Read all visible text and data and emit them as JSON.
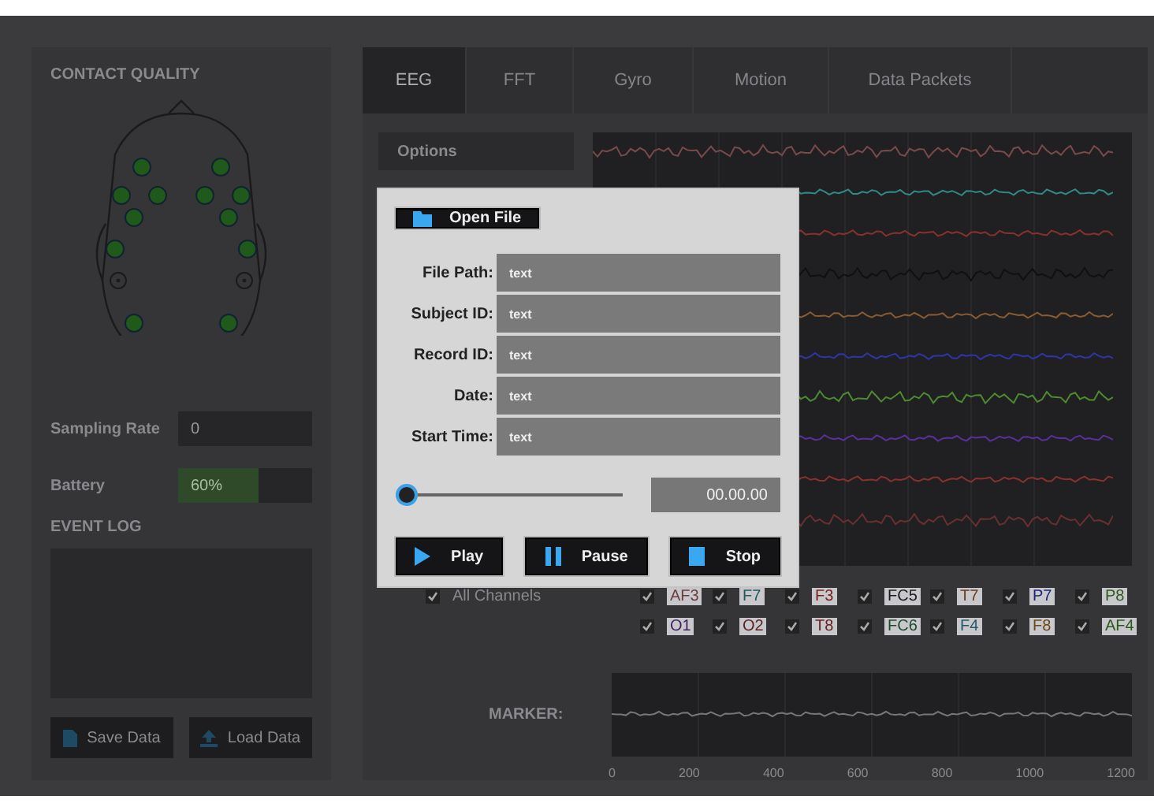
{
  "left_panel": {
    "title": "CONTACT QUALITY",
    "sampling_rate": {
      "label": "Sampling Rate",
      "value": "0"
    },
    "battery": {
      "label": "Battery",
      "level": 0.6,
      "reading": "60%"
    },
    "event_log": {
      "title": "EVENT LOG"
    },
    "buttons": [
      {
        "label": "Save Data",
        "kind": "save"
      },
      {
        "label": "Load Data",
        "kind": "load"
      }
    ]
  },
  "tabs": [
    {
      "label": "EEG",
      "selected": true
    },
    {
      "label": "FFT",
      "selected": false
    },
    {
      "label": "Gyro",
      "selected": false
    },
    {
      "label": "Motion",
      "selected": false
    },
    {
      "label": "Data Packets",
      "selected": false
    }
  ],
  "options": {
    "label": "Options"
  },
  "channels": {
    "all": {
      "label": "All Channels",
      "checked": true
    },
    "items": [
      {
        "label": "AF3",
        "checked": true,
        "color": "#6a3d3d"
      },
      {
        "label": "F7",
        "checked": true,
        "color": "#1f5a58"
      },
      {
        "label": "F3",
        "checked": true,
        "color": "#7a1e1e"
      },
      {
        "label": "FC5",
        "checked": true,
        "color": "#1a1a1a"
      },
      {
        "label": "T7",
        "checked": true,
        "color": "#6a3a1a"
      },
      {
        "label": "P7",
        "checked": true,
        "color": "#1e237a"
      },
      {
        "label": "P8",
        "checked": true,
        "color": "#2f5a1e"
      },
      {
        "label": "O1",
        "checked": true,
        "color": "#3e1f5c"
      },
      {
        "label": "O2",
        "checked": true,
        "color": "#5a1f1f"
      },
      {
        "label": "T8",
        "checked": true,
        "color": "#6a2020"
      },
      {
        "label": "FC6",
        "checked": true,
        "color": "#1f4a2a"
      },
      {
        "label": "F4",
        "checked": true,
        "color": "#1f5a66"
      },
      {
        "label": "F8",
        "checked": true,
        "color": "#6a4a14"
      },
      {
        "label": "AF4",
        "checked": true,
        "color": "#2a5a1a"
      }
    ]
  },
  "marker": {
    "label": "MARKER:",
    "x_ticks": [
      "0",
      "200",
      "400",
      "600",
      "800",
      "1000",
      "1200"
    ]
  },
  "dialog": {
    "open_button": "Open File",
    "fields": [
      {
        "label": "File Path:",
        "value": "text"
      },
      {
        "label": "Subject ID:",
        "value": "text"
      },
      {
        "label": "Record ID:",
        "value": "text"
      },
      {
        "label": "Date:",
        "value": "text"
      },
      {
        "label": "Start Time:",
        "value": "text"
      }
    ],
    "timeline": {
      "level": 0,
      "time": "00.00.00"
    },
    "buttons": [
      {
        "label": "Play",
        "kind": "play"
      },
      {
        "label": "Pause",
        "kind": "pause"
      },
      {
        "label": "Stop",
        "kind": "stop"
      }
    ]
  }
}
